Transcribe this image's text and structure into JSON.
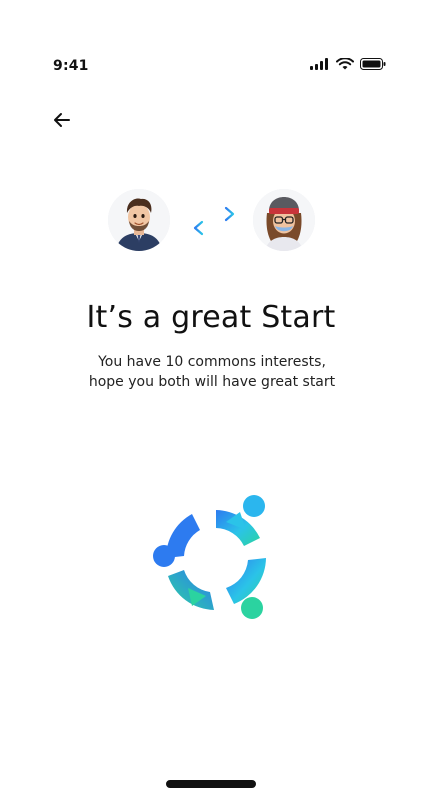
{
  "status_bar": {
    "time": "9:41",
    "icons": [
      "signal-icon",
      "wifi-icon",
      "battery-icon"
    ]
  },
  "nav": {
    "back_icon": "arrow-left-icon"
  },
  "match": {
    "swap_icon": "swap-arrows-icon"
  },
  "content": {
    "title": "It’s a great Start",
    "subtitle": "You have 10 commons interests, hope you both will have great start"
  },
  "colors": {
    "accent_blue": "#2D7BF0",
    "accent_cyan": "#2BC3E8",
    "accent_green": "#2BD3A0"
  }
}
